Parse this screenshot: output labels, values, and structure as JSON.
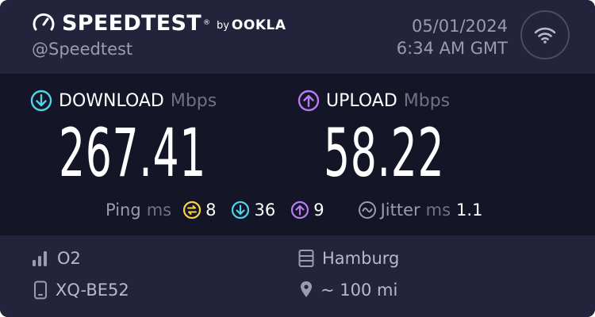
{
  "header": {
    "brand": "SPEEDTEST",
    "byline_by": "by",
    "byline_company": "OOKLA",
    "handle": "@Speedtest",
    "date": "05/01/2024",
    "time": "6:34 AM GMT",
    "status_icon": "wifi-icon"
  },
  "download": {
    "label": "DOWNLOAD",
    "unit": "Mbps",
    "value": "267.41",
    "color": "#4fd3e8"
  },
  "upload": {
    "label": "UPLOAD",
    "unit": "Mbps",
    "value": "58.22",
    "color": "#b57cf2"
  },
  "ping": {
    "label": "Ping",
    "unit": "ms",
    "idle": "8",
    "download": "36",
    "upload": "9",
    "idle_color": "#f5d24a"
  },
  "jitter": {
    "label": "Jitter",
    "unit": "ms",
    "value": "1.1"
  },
  "footer": {
    "provider": "O2",
    "device": "XQ-BE52",
    "server": "Hamburg",
    "distance": "~ 100 mi"
  }
}
